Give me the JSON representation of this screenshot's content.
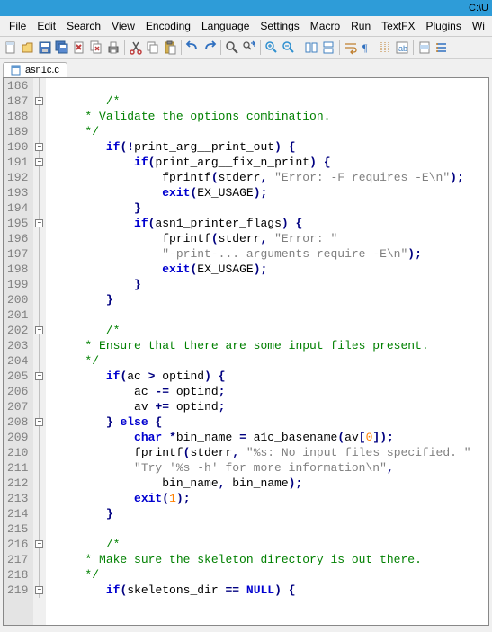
{
  "title_path": "C:\\U",
  "menu": {
    "file": "File",
    "edit": "Edit",
    "search": "Search",
    "view": "View",
    "encoding": "Encoding",
    "language": "Language",
    "settings": "Settings",
    "macro": "Macro",
    "run": "Run",
    "textfx": "TextFX",
    "plugins": "Plugins",
    "window": "Wi"
  },
  "tab": {
    "filename": "asn1c.c"
  },
  "code": {
    "first_line": 186,
    "lines": [
      {
        "n": 186,
        "t": ""
      },
      {
        "n": 187,
        "t": "        /*",
        "cls": "cmt"
      },
      {
        "n": 188,
        "t": "     * Validate the options combination.",
        "cls": "cmt"
      },
      {
        "n": 189,
        "t": "     */",
        "cls": "cmt"
      },
      {
        "n": 190,
        "t": "        if(!print_arg__print_out) {"
      },
      {
        "n": 191,
        "t": "            if(print_arg__fix_n_print) {"
      },
      {
        "n": 192,
        "t": "                fprintf(stderr, \"Error: -F requires -E\\n\");"
      },
      {
        "n": 193,
        "t": "                exit(EX_USAGE);"
      },
      {
        "n": 194,
        "t": "            }"
      },
      {
        "n": 195,
        "t": "            if(asn1_printer_flags) {"
      },
      {
        "n": 196,
        "t": "                fprintf(stderr, \"Error: \""
      },
      {
        "n": 197,
        "t": "                \"-print-... arguments require -E\\n\");"
      },
      {
        "n": 198,
        "t": "                exit(EX_USAGE);"
      },
      {
        "n": 199,
        "t": "            }"
      },
      {
        "n": 200,
        "t": "        }"
      },
      {
        "n": 201,
        "t": ""
      },
      {
        "n": 202,
        "t": "        /*",
        "cls": "cmt"
      },
      {
        "n": 203,
        "t": "     * Ensure that there are some input files present.",
        "cls": "cmt"
      },
      {
        "n": 204,
        "t": "     */",
        "cls": "cmt"
      },
      {
        "n": 205,
        "t": "        if(ac > optind) {"
      },
      {
        "n": 206,
        "t": "            ac -= optind;"
      },
      {
        "n": 207,
        "t": "            av += optind;"
      },
      {
        "n": 208,
        "t": "        } else {"
      },
      {
        "n": 209,
        "t": "            char *bin_name = a1c_basename(av[0]);"
      },
      {
        "n": 210,
        "t": "            fprintf(stderr, \"%s: No input files specified. \""
      },
      {
        "n": 211,
        "t": "            \"Try '%s -h' for more information\\n\","
      },
      {
        "n": 212,
        "t": "                bin_name, bin_name);"
      },
      {
        "n": 213,
        "t": "            exit(1);"
      },
      {
        "n": 214,
        "t": "        }"
      },
      {
        "n": 215,
        "t": ""
      },
      {
        "n": 216,
        "t": "        /*",
        "cls": "cmt"
      },
      {
        "n": 217,
        "t": "     * Make sure the skeleton directory is out there.",
        "cls": "cmt"
      },
      {
        "n": 218,
        "t": "     */",
        "cls": "cmt"
      },
      {
        "n": 219,
        "t": "        if(skeletons_dir == NULL) {"
      }
    ],
    "fold_markers": [
      187,
      190,
      191,
      195,
      202,
      205,
      208,
      216,
      219
    ]
  }
}
